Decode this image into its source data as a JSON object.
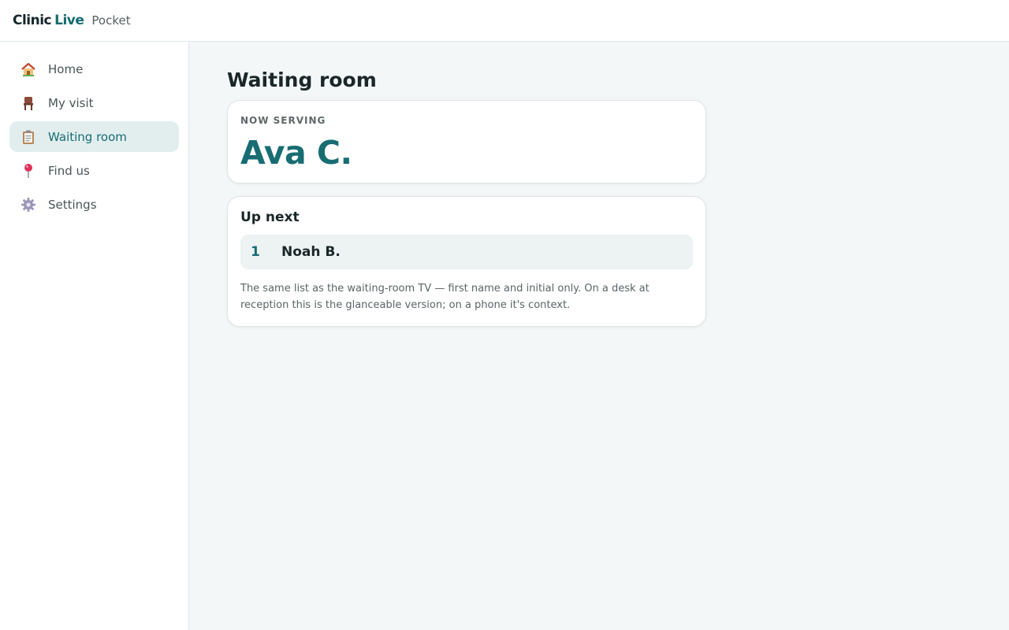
{
  "app": {
    "brand_part1": "Clinic",
    "brand_part2": "Live",
    "brand_sub": "Pocket"
  },
  "sidebar": {
    "items": [
      {
        "label": "Home",
        "icon": "house-icon",
        "active": false
      },
      {
        "label": "My visit",
        "icon": "chair-icon",
        "active": false
      },
      {
        "label": "Waiting room",
        "icon": "clipboard-icon",
        "active": true
      },
      {
        "label": "Find us",
        "icon": "pin-icon",
        "active": false
      },
      {
        "label": "Settings",
        "icon": "gear-icon",
        "active": false
      }
    ]
  },
  "main": {
    "title": "Waiting room",
    "now_serving": {
      "label": "NOW SERVING",
      "name": "Ava C."
    },
    "up_next": {
      "title": "Up next",
      "queue": [
        {
          "position": "1",
          "name": "Noah B."
        }
      ],
      "note": "The same list as the waiting-room TV — first name and initial only. On a desk at reception this is the glanceable version; on a phone it's context."
    }
  },
  "colors": {
    "accent": "#176d72",
    "active_nav_bg": "#e2eeee",
    "page_bg": "#f3f7f7"
  }
}
